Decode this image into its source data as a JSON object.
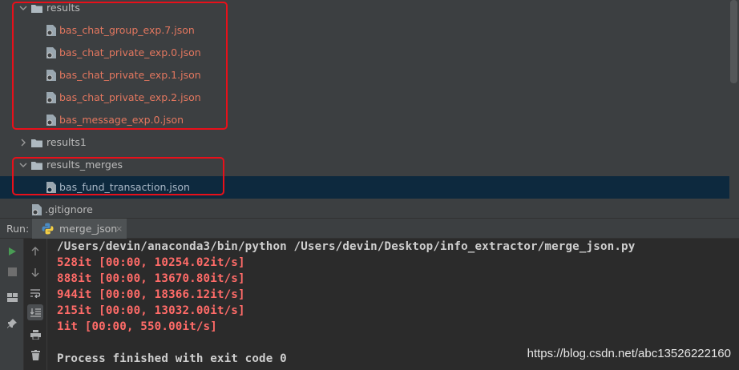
{
  "project_tree": {
    "results_folder": "results",
    "results_files": [
      "bas_chat_group_exp.7.json",
      "bas_chat_private_exp.0.json",
      "bas_chat_private_exp.1.json",
      "bas_chat_private_exp.2.json",
      "bas_message_exp.0.json"
    ],
    "results1_folder": "results1",
    "results_merges_folder": "results_merges",
    "results_merges_files": [
      "bas_fund_transaction.json"
    ],
    "gitignore": ".gitignore"
  },
  "run_panel": {
    "label": "Run:",
    "tab_name": "merge_json",
    "tab_close": "×"
  },
  "console": {
    "command": "/Users/devin/anaconda3/bin/python /Users/devin/Desktop/info_extractor/merge_json.py",
    "progress_lines": [
      "528it [00:00, 10254.02it/s]",
      "888it [00:00, 13670.80it/s]",
      "944it [00:00, 18366.12it/s]",
      "215it [00:00, 13032.00it/s]",
      "1it [00:00, 550.00it/s]"
    ],
    "exit_message": "Process finished with exit code 0"
  },
  "watermark": "https://blog.csdn.net/abc13526222160",
  "colors": {
    "tree_bg": "#3c3f41",
    "selection": "#0d293e",
    "modified_file": "#e3775f",
    "stderr_text": "#ff6b68",
    "highlight_box": "#e8101a"
  }
}
